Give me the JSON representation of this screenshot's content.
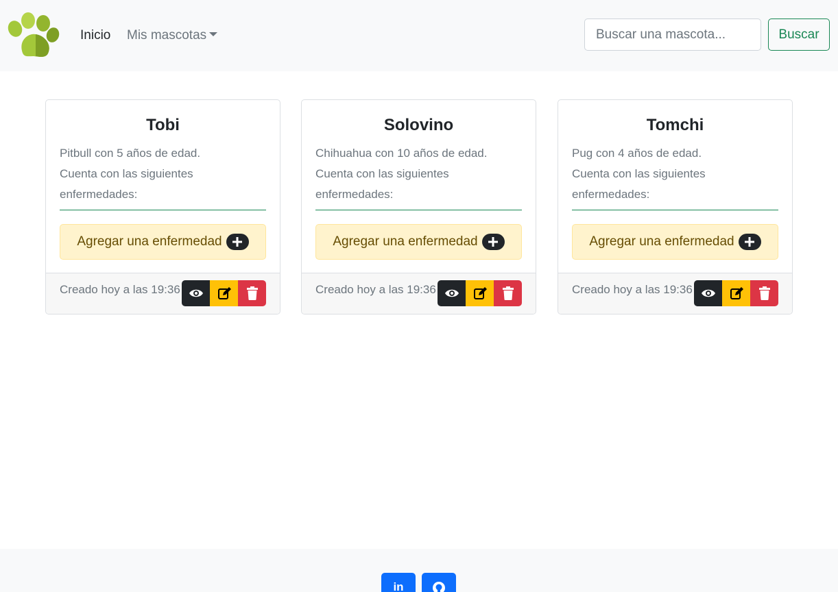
{
  "navbar": {
    "logo_icon": "paw-icon",
    "links": [
      {
        "label": "Inicio"
      },
      {
        "label": "Mis mascotas"
      }
    ],
    "search": {
      "placeholder": "Buscar una mascota...",
      "button_label": "Buscar"
    }
  },
  "pets": [
    {
      "name": "Tobi",
      "description": "Pitbull con 5 años de edad.",
      "diseases_label": "Cuenta con las siguientes enfermedades:",
      "add_button_label": "Agregar una enfermedad",
      "created": "Creado hoy a las 19:36"
    },
    {
      "name": "Solovino",
      "description": "Chihuahua con 10 años de edad.",
      "diseases_label": "Cuenta con las siguientes enfermedades:",
      "add_button_label": "Agregar una enfermedad",
      "created": "Creado hoy a las 19:36"
    },
    {
      "name": "Tomchi",
      "description": "Pug con 4 años de edad.",
      "diseases_label": "Cuenta con las siguientes enfermedades:",
      "add_button_label": "Agregar una enfermedad",
      "created": "Creado hoy a las 19:36"
    }
  ],
  "card_actions": [
    "eye-icon",
    "edit-icon",
    "trash-icon"
  ],
  "footer": {
    "social": [
      {
        "icon": "linkedin-icon"
      },
      {
        "icon": "github-icon"
      }
    ]
  },
  "colors": {
    "success": "#198754",
    "dark": "#212529",
    "warning": "#ffc107",
    "danger": "#dc3545",
    "primary": "#0d6efd",
    "warning_light": "#fff3cd"
  }
}
